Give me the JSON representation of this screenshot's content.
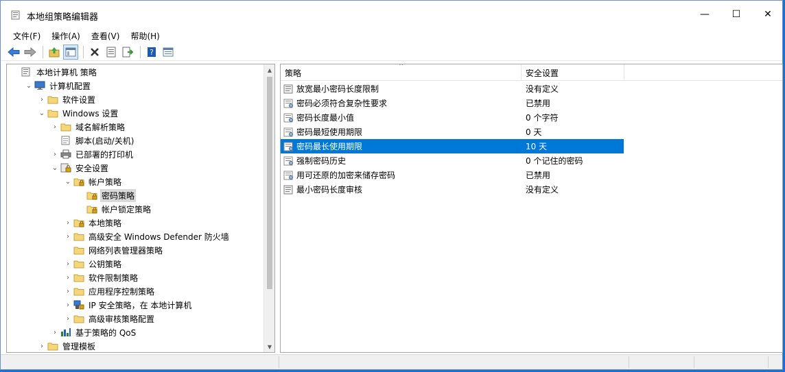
{
  "window": {
    "title": "本地组策略编辑器",
    "controls": {
      "minimize": "—",
      "maximize": "☐",
      "close": "✕"
    }
  },
  "menu": [
    "文件(F)",
    "操作(A)",
    "查看(V)",
    "帮助(H)"
  ],
  "toolbar": {
    "icons": [
      "back-icon",
      "forward-icon",
      "up-folder-icon",
      "show-tree-icon",
      "delete-icon",
      "properties-icon",
      "export-icon",
      "help-icon",
      "view-icon"
    ]
  },
  "tree": {
    "items": [
      {
        "label": "本地计算机 策略",
        "level": 0,
        "expander": "",
        "icon": "computer-policy-icon"
      },
      {
        "label": "计算机配置",
        "level": 1,
        "expander": "expanded",
        "icon": "computer-icon"
      },
      {
        "label": "软件设置",
        "level": 2,
        "expander": "collapsed",
        "icon": "folder-icon"
      },
      {
        "label": "Windows 设置",
        "level": 2,
        "expander": "expanded",
        "icon": "folder-icon"
      },
      {
        "label": "域名解析策略",
        "level": 3,
        "expander": "collapsed",
        "icon": "folder-icon"
      },
      {
        "label": "脚本(启动/关机)",
        "level": 3,
        "expander": "",
        "icon": "script-icon"
      },
      {
        "label": "已部署的打印机",
        "level": 3,
        "expander": "collapsed",
        "icon": "printer-icon"
      },
      {
        "label": "安全设置",
        "level": 3,
        "expander": "expanded",
        "icon": "security-icon"
      },
      {
        "label": "帐户策略",
        "level": 4,
        "expander": "expanded",
        "icon": "locked-folder-icon"
      },
      {
        "label": "密码策略",
        "level": 5,
        "expander": "",
        "icon": "locked-folder-icon",
        "selected": true
      },
      {
        "label": "帐户锁定策略",
        "level": 5,
        "expander": "",
        "icon": "locked-folder-icon"
      },
      {
        "label": "本地策略",
        "level": 4,
        "expander": "collapsed",
        "icon": "locked-folder-icon"
      },
      {
        "label": "高级安全 Windows Defender 防火墙",
        "level": 4,
        "expander": "collapsed",
        "icon": "folder-icon"
      },
      {
        "label": "网络列表管理器策略",
        "level": 4,
        "expander": "",
        "icon": "folder-icon"
      },
      {
        "label": "公钥策略",
        "level": 4,
        "expander": "collapsed",
        "icon": "folder-icon"
      },
      {
        "label": "软件限制策略",
        "level": 4,
        "expander": "collapsed",
        "icon": "folder-icon"
      },
      {
        "label": "应用程序控制策略",
        "level": 4,
        "expander": "collapsed",
        "icon": "folder-icon"
      },
      {
        "label": "IP 安全策略，在 本地计算机",
        "level": 4,
        "expander": "collapsed",
        "icon": "ip-security-icon"
      },
      {
        "label": "高级审核策略配置",
        "level": 4,
        "expander": "collapsed",
        "icon": "folder-icon"
      },
      {
        "label": "基于策略的 QoS",
        "level": 3,
        "expander": "collapsed",
        "icon": "chart-icon"
      },
      {
        "label": "管理模板",
        "level": 2,
        "expander": "collapsed",
        "icon": "folder-icon"
      }
    ]
  },
  "list": {
    "columns": [
      "策略",
      "安全设置"
    ],
    "rows": [
      {
        "policy": "放宽最小密码长度限制",
        "setting": "没有定义",
        "icon": "policy-doc-icon"
      },
      {
        "policy": "密码必须符合复杂性要求",
        "setting": "已禁用",
        "icon": "policy-icon"
      },
      {
        "policy": "密码长度最小值",
        "setting": "0 个字符",
        "icon": "policy-icon"
      },
      {
        "policy": "密码最短使用期限",
        "setting": "0 天",
        "icon": "policy-icon"
      },
      {
        "policy": "密码最长使用期限",
        "setting": "10 天",
        "icon": "policy-icon",
        "selected": true
      },
      {
        "policy": "强制密码历史",
        "setting": "0 个记住的密码",
        "icon": "policy-icon"
      },
      {
        "policy": "用可还原的加密来储存密码",
        "setting": "已禁用",
        "icon": "policy-icon"
      },
      {
        "policy": "最小密码长度审核",
        "setting": "没有定义",
        "icon": "policy-doc-icon"
      }
    ]
  },
  "colors": {
    "selection": "#0078d7",
    "tree_selection": "#d9d9d9",
    "desktop": "#1f6fd0"
  }
}
